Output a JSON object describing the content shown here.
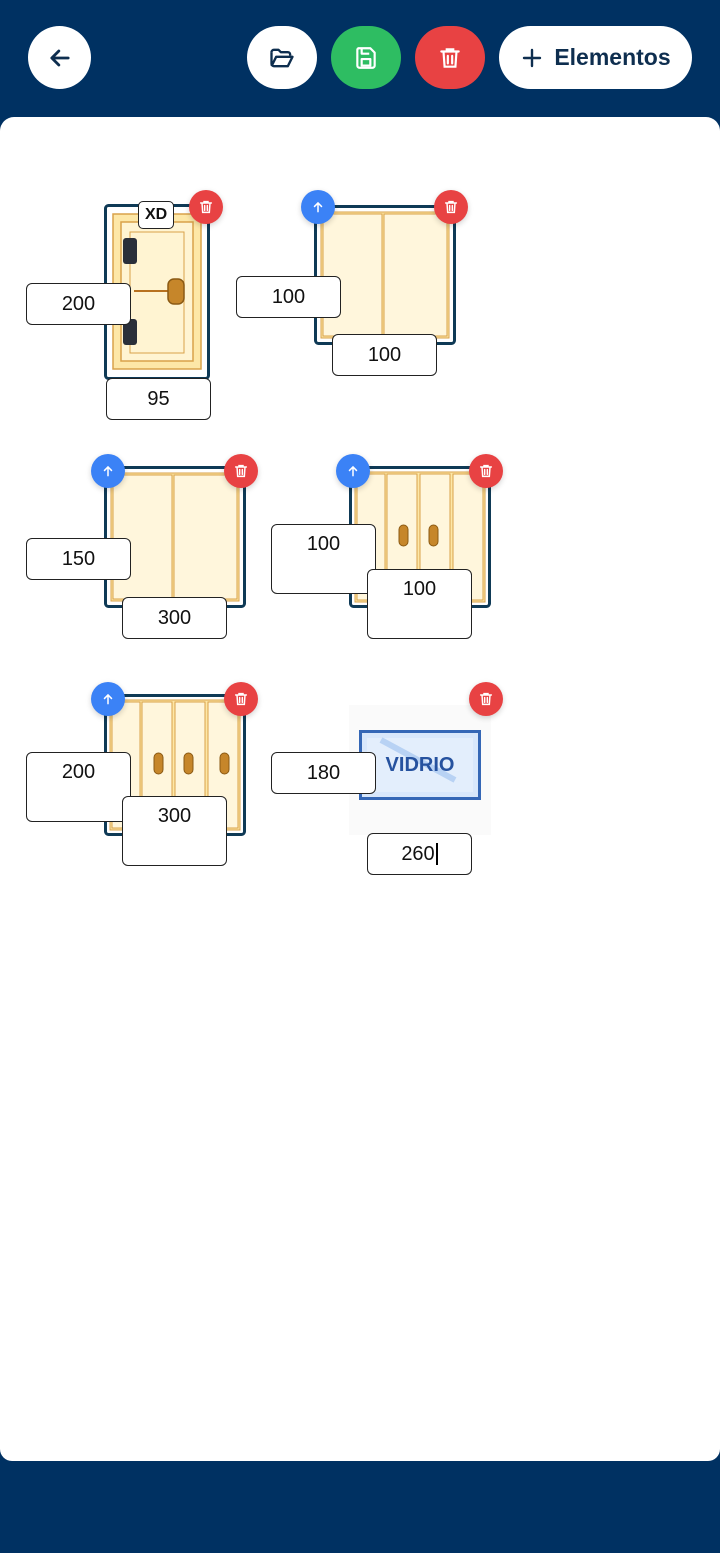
{
  "toolbar": {
    "add_label": "Elementos",
    "icons": {
      "back": "arrow-left-icon",
      "open": "folder-open-icon",
      "save": "save-icon",
      "delete": "trash-icon",
      "add": "plus-icon"
    },
    "colors": {
      "bar": "#003162",
      "save": "#2ebd62",
      "delete": "#e84243",
      "move": "#3b82f6"
    }
  },
  "elements": [
    {
      "id": "c1",
      "tag": "XD",
      "height": "200",
      "width": "95"
    },
    {
      "id": "c2",
      "height": "100",
      "width": "100"
    },
    {
      "id": "c3",
      "height": "150",
      "width": "300"
    },
    {
      "id": "c4",
      "height": "100",
      "width": "100"
    },
    {
      "id": "c5",
      "height": "200",
      "width": "300"
    },
    {
      "id": "c6",
      "label": "VIDRIO",
      "height": "180",
      "width": "260"
    }
  ]
}
